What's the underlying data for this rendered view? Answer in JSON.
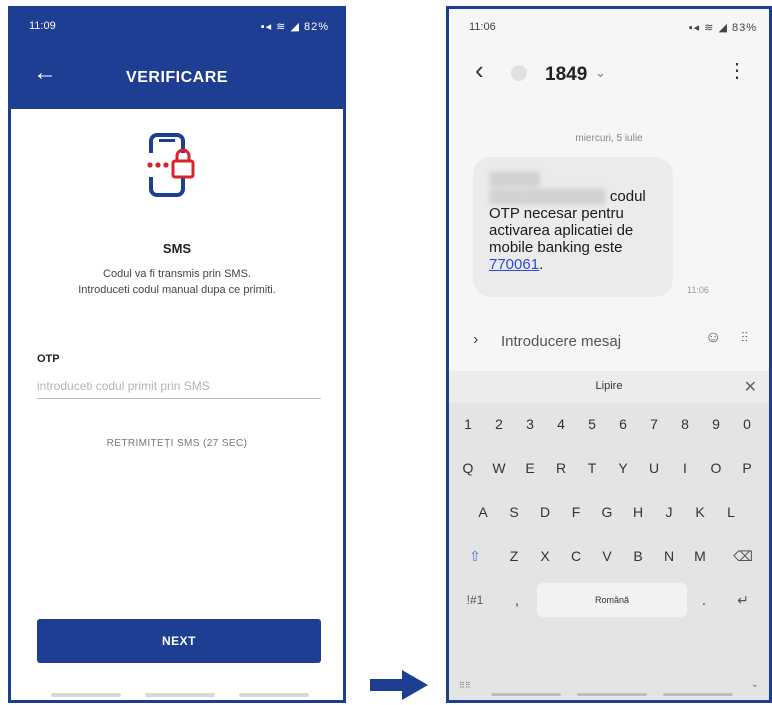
{
  "left_screen": {
    "status": {
      "time": "11:09",
      "battery": "82%"
    },
    "header": {
      "title": "VERIFICARE"
    },
    "method": {
      "title": "SMS",
      "description_line1": "Codul va fi transmis prin SMS.",
      "description_line2": "Introduceti codul manual dupa ce primiti."
    },
    "otp": {
      "label": "OTP",
      "placeholder": "introduceti codul primit prin SMS",
      "value": ""
    },
    "resend_label": "RETRIMITEȚI SMS (27 SEC)",
    "next_label": "NEXT",
    "colors": {
      "primary": "#1e3e94",
      "accent_red": "#d8232a"
    },
    "icons": {
      "back": "arrow-left-icon",
      "sms": "phone-lock-icon"
    }
  },
  "right_screen": {
    "status": {
      "time": "11:06",
      "battery": "83%"
    },
    "conversation": {
      "contact": "1849",
      "date": "miercuri, 5 iulie",
      "message": {
        "sender_blurred_1": "Stimate",
        "sender_blurred_2": "client Patria Bank",
        "text_part": "codul OTP necesar pentru activarea aplicatiei de mobile banking este",
        "code": "770061",
        "suffix": ".",
        "time": "11:06"
      }
    },
    "composer": {
      "placeholder": "Introducere mesaj"
    },
    "suggestion": {
      "word": "Lipire"
    },
    "keyboard": {
      "numbers": [
        "1",
        "2",
        "3",
        "4",
        "5",
        "6",
        "7",
        "8",
        "9",
        "0"
      ],
      "row1": [
        "Q",
        "W",
        "E",
        "R",
        "T",
        "Y",
        "U",
        "I",
        "O",
        "P"
      ],
      "row2": [
        "A",
        "S",
        "D",
        "F",
        "G",
        "H",
        "J",
        "K",
        "L"
      ],
      "row3": [
        "Z",
        "X",
        "C",
        "V",
        "B",
        "N",
        "M"
      ],
      "symbols_label": "!#1",
      "comma": ",",
      "space_label": "Română",
      "period": ".",
      "shift_glyph": "⇧",
      "backspace_glyph": "⌫",
      "enter_glyph": "↵",
      "down_glyph": "⌄"
    },
    "colors": {
      "link": "#2b4cd8"
    },
    "icons": {
      "back": "chevron-left-icon",
      "more": "more-vertical-icon",
      "emoji": "emoji-icon",
      "voice": "voice-wave-icon"
    }
  },
  "flow": {
    "arrow": "arrow-right-icon",
    "color": "#1e3e94"
  }
}
